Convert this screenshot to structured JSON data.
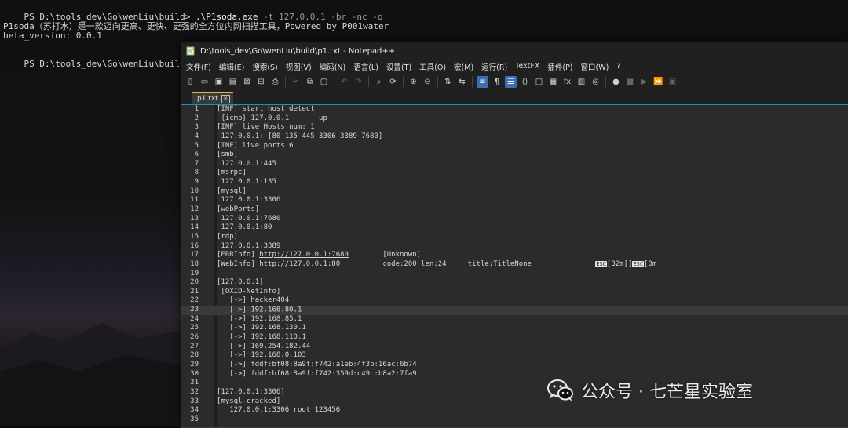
{
  "terminal": {
    "prompt1": "PS D:\\tools_dev\\Go\\wenLiu\\build> ",
    "command": ".\\P1soda.exe",
    "args": " -t 127.0.0.1 -br -nc -o",
    "output1": "P1soda（苏打水）是一款迈向更高、更快、更强的全方位内网扫描工具，Powered by P001water",
    "output2": "beta_version: 0.0.1",
    "prompt2": "PS D:\\tools_dev\\Go\\wenLiu\\build> "
  },
  "window": {
    "title": "D:\\tools_dev\\Go\\wenLiu\\build\\p1.txt - Notepad++"
  },
  "menu": [
    "文件(F)",
    "编辑(E)",
    "搜索(S)",
    "视图(V)",
    "编码(N)",
    "语言(L)",
    "设置(T)",
    "工具(O)",
    "宏(M)",
    "运行(R)",
    "TextFX",
    "插件(P)",
    "窗口(W)",
    "?"
  ],
  "toolbar_icons": [
    "new-file-icon",
    "open-file-icon",
    "save-icon",
    "save-all-icon",
    "close-icon",
    "close-all-icon",
    "print-icon",
    "sep",
    "cut-icon",
    "copy-icon",
    "paste-icon",
    "sep",
    "undo-icon",
    "redo-icon",
    "sep",
    "find-icon",
    "replace-icon",
    "sep",
    "zoom-in-icon",
    "zoom-out-icon",
    "sep",
    "sync-vertical-icon",
    "sync-horizontal-icon",
    "sep",
    "word-wrap-icon",
    "show-all-chars-icon",
    "indent-guide-icon",
    "xml-tag-icon",
    "doc-map-icon",
    "function-list-icon",
    "fx-icon",
    "folder-workspace-icon",
    "monitor-icon",
    "sep",
    "record-macro-icon",
    "stop-macro-icon",
    "play-macro-icon",
    "run-macro-multiple-icon",
    "save-macro-icon"
  ],
  "tab": {
    "label": "p1.txt"
  },
  "editor": {
    "current_line": 23,
    "lines": [
      "[INF] start host detect",
      " {icmp} 127.0.0.1       up",
      "[INF] live Hosts num: 1",
      " 127.0.0.1: [80 135 445 3306 3389 7680]",
      "[INF] live ports 6",
      "[smb]",
      " 127.0.0.1:445",
      "[msrpc]",
      " 127.0.0.1:135",
      "[mysql]",
      " 127.0.0.1:3306",
      "[webPorts]",
      " 127.0.0.1:7680",
      " 127.0.0.1:80",
      "[rdp]",
      " 127.0.0.1:3389",
      "[ERRInfo] |http://127.0.0.1:7680|        [Unknown]",
      "[WebInfo] |http://127.0.0.1:80|          code:200 len:24     title:TitleNone               #ESC#[32m[]#ESC#[0m",
      "",
      "[127.0.0.1]",
      " [OXID-NetInfo]",
      "   [->] hacker404",
      "   [->] 192.168.80.1",
      "   [->] 192.168.85.1",
      "   [->] 192.168.130.1",
      "   [->] 192.168.110.1",
      "   [->] 169.254.182.44",
      "   [->] 192.168.0.103",
      "   [->] fddf:bf08:8a9f:f742:a1eb:4f3b:16ac:6b74",
      "   [->] fddf:bf08:8a9f:f742:359d:c49c:b8a2:7fa9",
      "",
      "[127.0.0.1:3306]",
      "[mysql-cracked]",
      "   127.0.0.1:3306 root 123456",
      ""
    ]
  },
  "watermark": {
    "text": "公众号 · 七芒星实验室"
  }
}
